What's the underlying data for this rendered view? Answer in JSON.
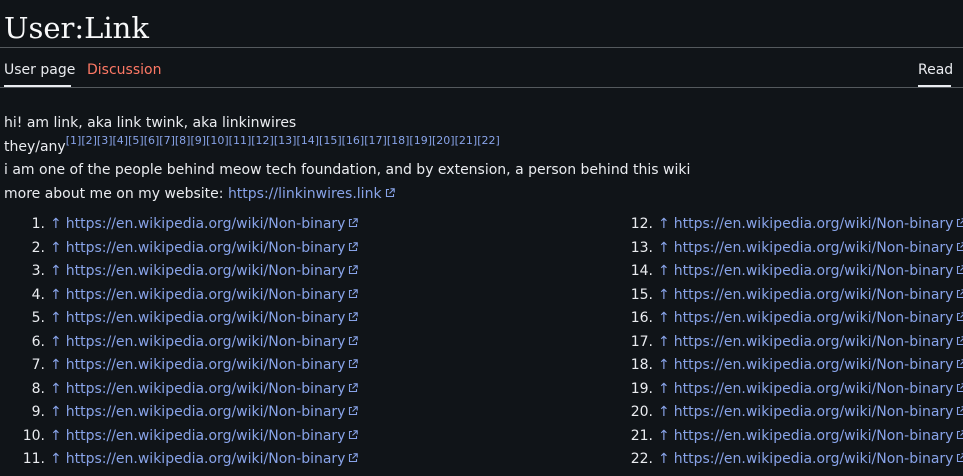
{
  "page": {
    "title": "User:Link"
  },
  "tabs": {
    "user_page": "User page",
    "discussion": "Discussion",
    "read": "Read"
  },
  "content": {
    "line1": "hi! am link, aka link twink, aka linkinwires",
    "pronouns": "they/any",
    "ref_markers": [
      "[1]",
      "[2]",
      "[3]",
      "[4]",
      "[5]",
      "[6]",
      "[7]",
      "[8]",
      "[9]",
      "[10]",
      "[11]",
      "[12]",
      "[13]",
      "[14]",
      "[15]",
      "[16]",
      "[17]",
      "[18]",
      "[19]",
      "[20]",
      "[21]",
      "[22]"
    ],
    "line3": "i am one of the people behind meow tech foundation, and by extension, a person behind this wiki",
    "line4_prefix": "more about me on my website: ",
    "website_link": "https://linkinwires.link"
  },
  "references": {
    "back_arrow": "↑",
    "items": [
      {
        "num": "1.",
        "url": "https://en.wikipedia.org/wiki/Non-binary"
      },
      {
        "num": "2.",
        "url": "https://en.wikipedia.org/wiki/Non-binary"
      },
      {
        "num": "3.",
        "url": "https://en.wikipedia.org/wiki/Non-binary"
      },
      {
        "num": "4.",
        "url": "https://en.wikipedia.org/wiki/Non-binary"
      },
      {
        "num": "5.",
        "url": "https://en.wikipedia.org/wiki/Non-binary"
      },
      {
        "num": "6.",
        "url": "https://en.wikipedia.org/wiki/Non-binary"
      },
      {
        "num": "7.",
        "url": "https://en.wikipedia.org/wiki/Non-binary"
      },
      {
        "num": "8.",
        "url": "https://en.wikipedia.org/wiki/Non-binary"
      },
      {
        "num": "9.",
        "url": "https://en.wikipedia.org/wiki/Non-binary"
      },
      {
        "num": "10.",
        "url": "https://en.wikipedia.org/wiki/Non-binary"
      },
      {
        "num": "11.",
        "url": "https://en.wikipedia.org/wiki/Non-binary"
      },
      {
        "num": "12.",
        "url": "https://en.wikipedia.org/wiki/Non-binary"
      },
      {
        "num": "13.",
        "url": "https://en.wikipedia.org/wiki/Non-binary"
      },
      {
        "num": "14.",
        "url": "https://en.wikipedia.org/wiki/Non-binary"
      },
      {
        "num": "15.",
        "url": "https://en.wikipedia.org/wiki/Non-binary"
      },
      {
        "num": "16.",
        "url": "https://en.wikipedia.org/wiki/Non-binary"
      },
      {
        "num": "17.",
        "url": "https://en.wikipedia.org/wiki/Non-binary"
      },
      {
        "num": "18.",
        "url": "https://en.wikipedia.org/wiki/Non-binary"
      },
      {
        "num": "19.",
        "url": "https://en.wikipedia.org/wiki/Non-binary"
      },
      {
        "num": "20.",
        "url": "https://en.wikipedia.org/wiki/Non-binary"
      },
      {
        "num": "21.",
        "url": "https://en.wikipedia.org/wiki/Non-binary"
      },
      {
        "num": "22.",
        "url": "https://en.wikipedia.org/wiki/Non-binary"
      }
    ]
  },
  "colors": {
    "background": "#101418",
    "text": "#eaecf0",
    "link": "#88a3e8",
    "discussion_tab": "#fd7865",
    "rule": "#54595d"
  },
  "icons": {
    "external_link": "external-link-icon"
  }
}
